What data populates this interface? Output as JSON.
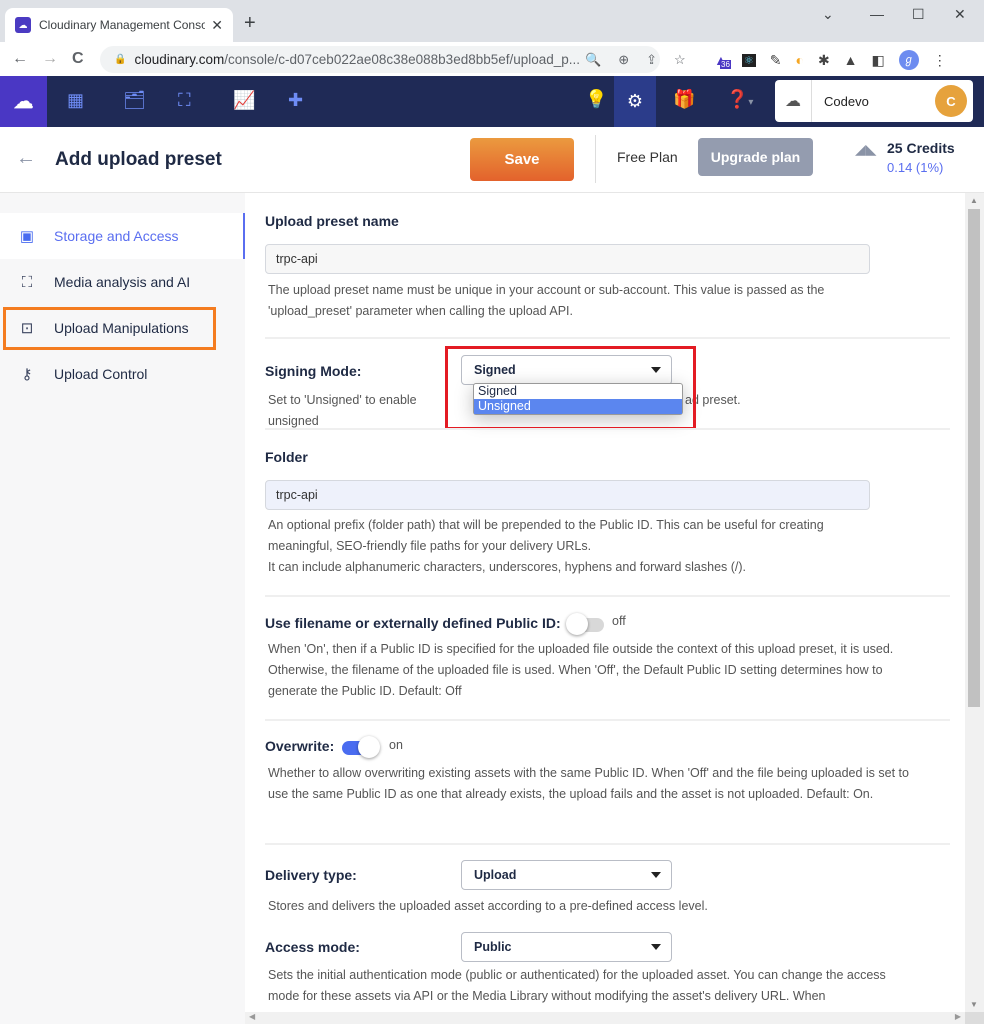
{
  "browser": {
    "tab_title": "Cloudinary Management Console",
    "new_tab": "+",
    "url_host": "cloudinary.com",
    "url_path": "/console/c-d07ceb022ae08c38e088b3ed8bb5ef/upload_p...",
    "window_controls": {
      "dropdown": "⌄",
      "minimize": "—",
      "maximize": "☐",
      "close": "✕"
    },
    "nav": {
      "back": "←",
      "forward": "→",
      "reload": "C"
    },
    "extension_badge": "36"
  },
  "app_header": {
    "logo": "Cloudinary",
    "nav_icons": [
      "dashboard-icon",
      "media-library-icon",
      "transformations-icon",
      "reports-icon",
      "addons-icon"
    ],
    "right_icons": [
      "lightbulb-icon",
      "settings-icon",
      "whats-new-icon",
      "help-icon"
    ],
    "cloud_name": "Codevo",
    "avatar_initial": "C",
    "accent": "#4a37c4"
  },
  "page_header": {
    "title": "Add upload preset",
    "save_label": "Save",
    "plan": "Free Plan",
    "upgrade_label": "Upgrade plan",
    "credits": "25 Credits",
    "credits_usage": "0.14 (1%)"
  },
  "sidebar": {
    "items": [
      {
        "label": "Storage and Access",
        "icon": "file-settings-icon",
        "active": true
      },
      {
        "label": "Media analysis and AI",
        "icon": "image-analysis-icon",
        "active": false
      },
      {
        "label": "Upload Manipulations",
        "icon": "crop-frame-icon",
        "active": false,
        "highlighted": true
      },
      {
        "label": "Upload Control",
        "icon": "key-icon",
        "active": false
      }
    ]
  },
  "form": {
    "preset_name": {
      "label": "Upload preset name",
      "value": "trpc-api",
      "help": "The upload preset name must be unique in your account or sub-account. This value is passed as the 'upload_preset' parameter when calling the upload API."
    },
    "signing_mode": {
      "label": "Signing Mode:",
      "value": "Signed",
      "options": [
        "Signed",
        "Unsigned"
      ],
      "hovered_option": "Unsigned",
      "help_left": "Set to 'Unsigned' to enable unsigned",
      "help_right": "ad preset."
    },
    "folder": {
      "label": "Folder",
      "value": "trpc-api",
      "help_lines": [
        "An optional prefix (folder path) that will be prepended to the Public ID. This can be useful for creating",
        "meaningful, SEO-friendly file paths for your delivery URLs.",
        "It can include alphanumeric characters, underscores, hyphens and forward slashes (/)."
      ]
    },
    "use_filename": {
      "label": "Use filename or externally defined Public ID:",
      "state": "off",
      "help": "When 'On', then if a Public ID is specified for the uploaded file outside the context of this upload preset, it is used. Otherwise, the filename of the uploaded file is used. When 'Off', the Default Public ID setting determines how to generate the Public ID. Default: Off"
    },
    "overwrite": {
      "label": "Overwrite:",
      "state": "on",
      "help": "Whether to allow overwriting existing assets with the same Public ID. When 'Off' and the file being uploaded is set to use the same Public ID as one that already exists, the upload fails and the asset is not uploaded. Default: On."
    },
    "delivery_type": {
      "label": "Delivery type:",
      "value": "Upload",
      "help": "Stores and delivers the uploaded asset according to a pre-defined access level."
    },
    "access_mode": {
      "label": "Access mode:",
      "value": "Public",
      "help": "Sets the initial authentication mode (public or authenticated) for the uploaded asset. You can change the access mode for these assets via API or the Media Library without modifying the asset's delivery URL. When"
    }
  },
  "colors": {
    "save": "#e8772f",
    "link": "#5a6ef0",
    "highlight_orange": "#f47c20",
    "highlight_red": "#e31b23",
    "toggle_on": "#4a6cf0"
  }
}
